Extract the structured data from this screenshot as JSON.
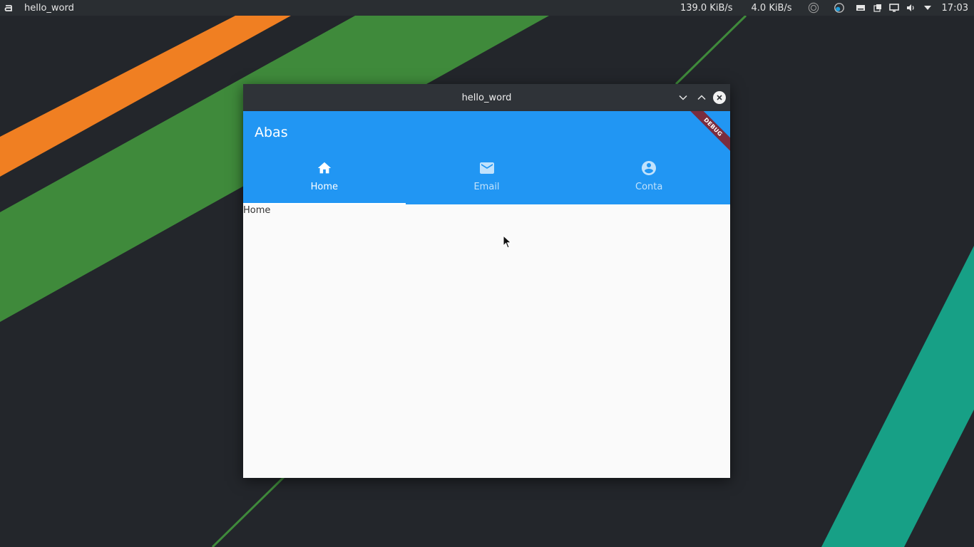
{
  "panel": {
    "app_title": "hello_word",
    "net_down": "139.0 KiB/s",
    "net_up": "4.0 KiB/s",
    "clock": "17:03",
    "tray_icons": [
      "activity-icon",
      "update-icon",
      "storage-icon",
      "clipboard-icon",
      "display-icon",
      "volume-icon",
      "chevron-down-icon"
    ]
  },
  "window": {
    "title": "hello_word",
    "controls": [
      "minimize",
      "maximize",
      "close"
    ]
  },
  "app": {
    "title": "Abas",
    "debug_banner": "DEBUG",
    "tabs": [
      {
        "label": "Home",
        "icon": "home-icon",
        "active": true
      },
      {
        "label": "Email",
        "icon": "email-icon",
        "active": false
      },
      {
        "label": "Conta",
        "icon": "account-circle-icon",
        "active": false
      }
    ],
    "body_text": "Home"
  },
  "colors": {
    "accent": "#2196f3",
    "panel": "#2a2e32",
    "titlebar": "#2f3338",
    "debug": "#7a2c3e"
  }
}
